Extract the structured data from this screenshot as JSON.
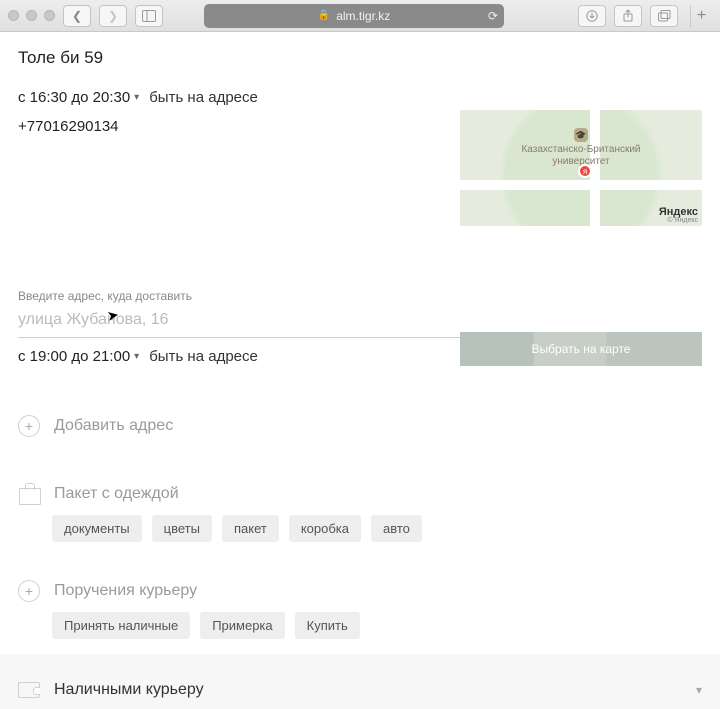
{
  "browser": {
    "url": "alm.tigr.kz"
  },
  "address1": {
    "street": "Толе  би 59",
    "time": "с 16:30 до 20:30",
    "hint": "быть на адресе",
    "phone": "+77016290134"
  },
  "map1": {
    "poi_line1": "Казахстанско-Британский",
    "poi_line2": "университет",
    "brand": "Яндекс",
    "brand_sub": "© Яндекс"
  },
  "address2": {
    "label": "Введите адрес, куда доставить",
    "placeholder": "улица Жубанова, 16",
    "value": "",
    "time": "с 19:00 до 21:00",
    "hint": "быть на адресе",
    "map_button": "Выбрать на карте"
  },
  "add_address": {
    "label": "Добавить адрес"
  },
  "package": {
    "label": "Пакет с одеждой",
    "tags": [
      "документы",
      "цветы",
      "пакет",
      "коробка",
      "авто"
    ]
  },
  "instructions": {
    "label": "Поручения курьеру",
    "tags": [
      "Принять наличные",
      "Примерка",
      "Купить"
    ]
  },
  "payment": {
    "label": "Наличными курьеру"
  }
}
